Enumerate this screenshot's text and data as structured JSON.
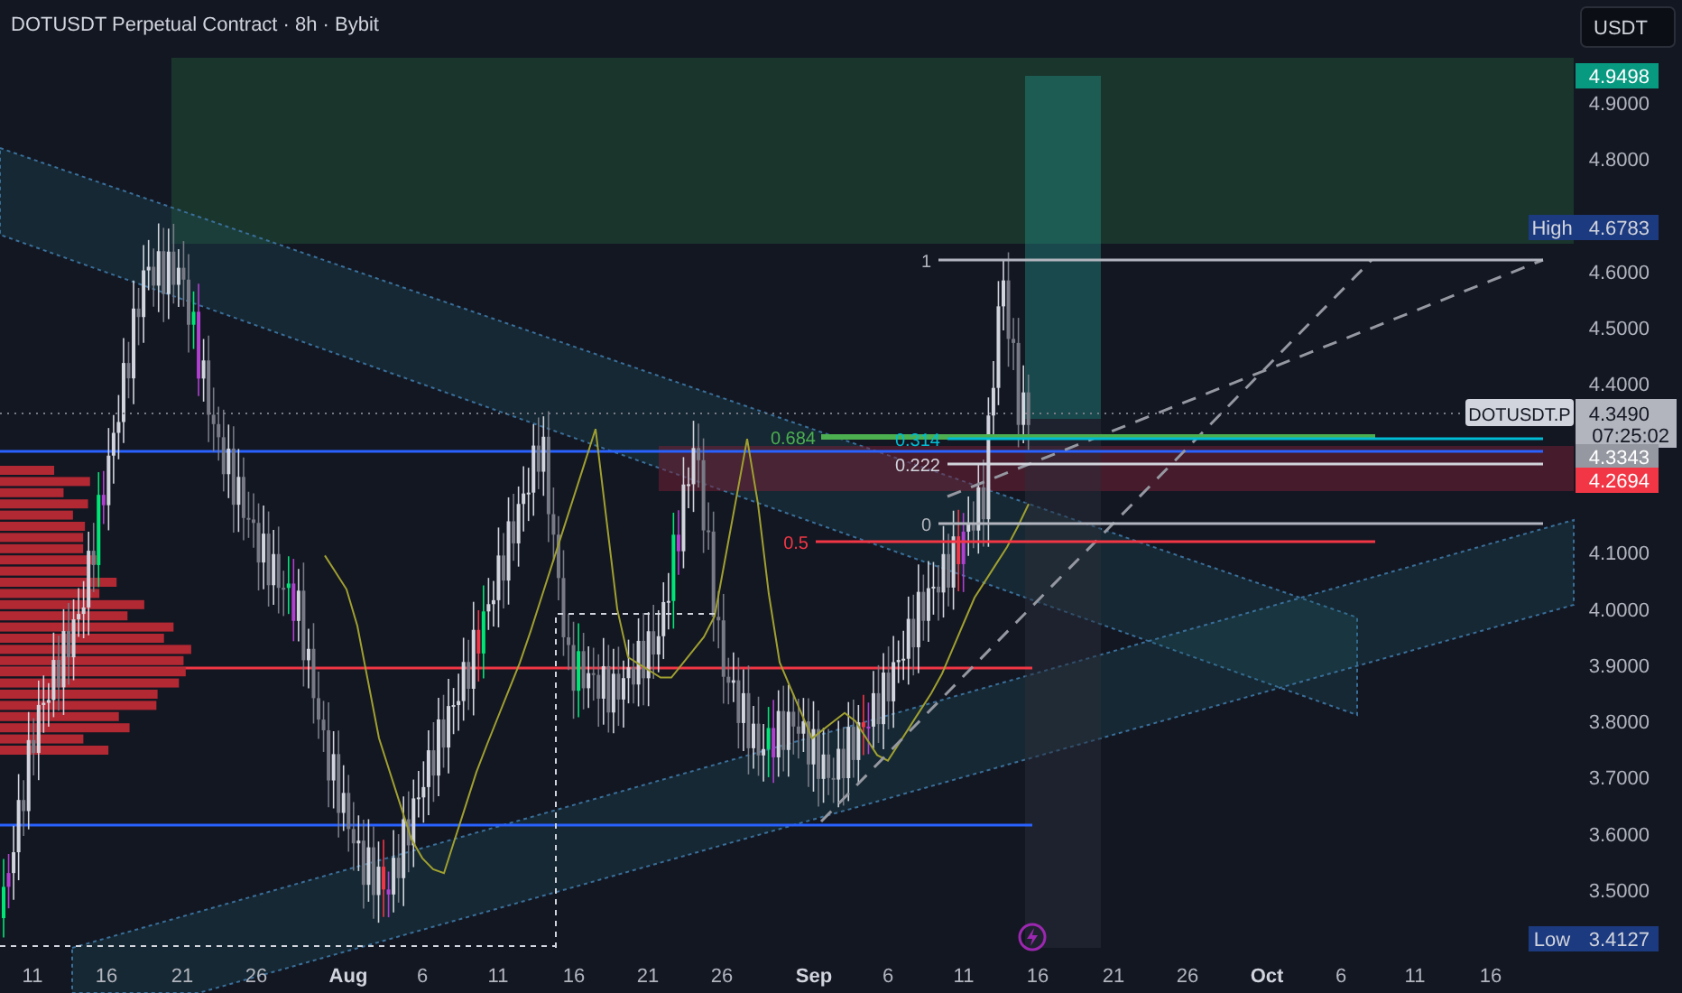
{
  "header": {
    "title": "DOTUSDT Perpetual Contract · 8h · Bybit"
  },
  "currency_button": "USDT",
  "price_axis": [
    "4.9000",
    "4.8000",
    "4.6000",
    "4.5000",
    "4.4000",
    "4.1000",
    "4.0000",
    "3.9000",
    "3.8000",
    "3.7000",
    "3.6000",
    "3.5000"
  ],
  "price_tags": [
    {
      "kind": "plain",
      "value": "4.9498",
      "color": "#089981"
    },
    {
      "kind": "labeled",
      "label": "High",
      "value": "4.6783",
      "color": "#1c3a80"
    },
    {
      "kind": "symbol",
      "label": "DOTUSDT.P",
      "value": "4.3490",
      "countdown": "07:25:02",
      "color": "#b2b5be"
    },
    {
      "kind": "plain",
      "value": "4.3343",
      "color": "#9598a1"
    },
    {
      "kind": "plain",
      "value": "4.2694",
      "color": "#f23645"
    },
    {
      "kind": "labeled",
      "label": "Low",
      "value": "3.4127",
      "color": "#1c3a80"
    }
  ],
  "fib_levels": [
    {
      "label": "1",
      "color": "#b2b5be"
    },
    {
      "label": "0.684",
      "color": "#4caf50"
    },
    {
      "label": "0.314",
      "color": "#00bcd4"
    },
    {
      "label": "0.222",
      "color": "#d1d4dc"
    },
    {
      "label": "0",
      "color": "#b2b5be"
    },
    {
      "label": "0.5",
      "color": "#f23645"
    }
  ],
  "time_axis": [
    {
      "label": "11",
      "month": false
    },
    {
      "label": "16",
      "month": false
    },
    {
      "label": "21",
      "month": false
    },
    {
      "label": "26",
      "month": false
    },
    {
      "label": "Aug",
      "month": true
    },
    {
      "label": "6",
      "month": false
    },
    {
      "label": "11",
      "month": false
    },
    {
      "label": "16",
      "month": false
    },
    {
      "label": "21",
      "month": false
    },
    {
      "label": "26",
      "month": false
    },
    {
      "label": "Sep",
      "month": true
    },
    {
      "label": "6",
      "month": false
    },
    {
      "label": "11",
      "month": false
    },
    {
      "label": "16",
      "month": false
    },
    {
      "label": "21",
      "month": false
    },
    {
      "label": "26",
      "month": false
    },
    {
      "label": "Oct",
      "month": true
    },
    {
      "label": "6",
      "month": false
    },
    {
      "label": "11",
      "month": false
    },
    {
      "label": "16",
      "month": false
    }
  ]
}
